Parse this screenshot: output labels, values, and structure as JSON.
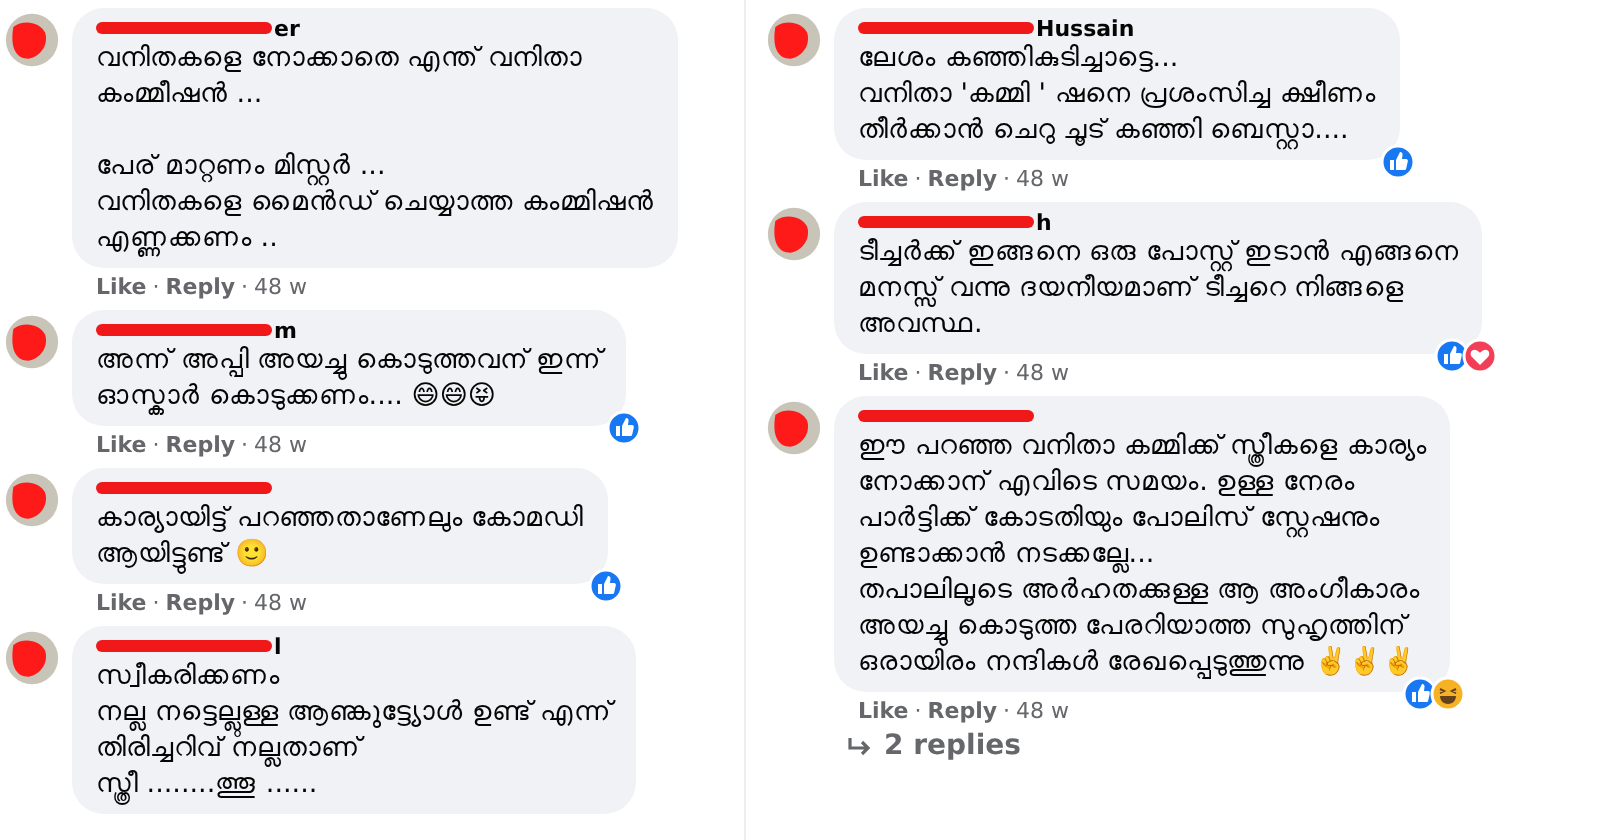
{
  "panels": [
    {
      "comments": [
        {
          "name": "er",
          "text": "വനിതകളെ നോക്കാതെ എന്ത് വനിതാ\nകംമ്മീഷൻ ...\n\nപേര് മാറ്റണം മിസ്റ്റർ ...\nവനിതകളെ മൈൻഡ് ചെയ്യാത്ത കംമ്മിഷൻ\nഎണ്ണക്കണം ..",
          "actions": [
            "Like",
            "Reply"
          ],
          "separator": "·",
          "time": "48 w"
        },
        {
          "name": "m",
          "text": "അന്ന് അപ്പി അയച്ചു കൊടുത്തവന് ഇന്ന്\nഓസ്കാർ കൊടുക്കണം.... 😄😄😝",
          "actions": [
            "Like",
            "Reply"
          ],
          "separator": "·",
          "time": "48 w",
          "reactions": [
            {
              "kind": "like"
            }
          ]
        },
        {
          "text": "കാര്യായിട്ട് പറഞ്ഞതാണേലും കോമഡി\nആയിട്ടുണ്ട് 🙂",
          "actions": [
            "Like",
            "Reply"
          ],
          "separator": "·",
          "time": "48 w",
          "reactions": [
            {
              "kind": "like"
            }
          ]
        },
        {
          "name": "l",
          "text": "സ്വീകരിക്കണം\nനല്ല നട്ടെല്ലുള്ള ആണ്കുട്ട്യോൾ ഉണ്ട് എന്ന്\nതിരിച്ചറിവ് നല്ലതാണ്\nസ്ത്രീ ........ത്തൂ ......"
        }
      ]
    },
    {
      "comments": [
        {
          "name": "Hussain",
          "text": "ലേശം കഞ്ഞികുടിച്ചാട്ടെ...\nവനിതാ 'കമ്മി ' ഷനെ പ്രശംസിച്ച ക്ഷീണം\nതീർക്കാൻ ചെറു ചൂട് കഞ്ഞി ബെസ്റ്റാ....",
          "actions": [
            "Like",
            "Reply"
          ],
          "separator": "·",
          "time": "48 w",
          "reactions": [
            {
              "kind": "like"
            }
          ]
        },
        {
          "name": "h",
          "text": "ടീച്ചർക്ക് ഇങ്ങനെ ഒരു പോസ്റ്റ് ഇടാൻ എങ്ങനെ\nമനസ്സ് വന്നു ദയനീയമാണ് ടീച്ചറെ നിങ്ങളെ\nഅവസ്ഥ.",
          "actions": [
            "Like",
            "Reply"
          ],
          "separator": "·",
          "time": "48 w",
          "reactions": [
            {
              "kind": "like"
            },
            {
              "kind": "love"
            }
          ]
        },
        {
          "text": "ഈ പറഞ്ഞ വനിതാ കമ്മിക്ക് സ്ത്രീകളെ കാര്യം\nനോക്കാന് എവിടെ സമയം. ഉള്ള നേരം\nപാർട്ടിക്ക് കോടതിയും പോലിസ് സ്റ്റേഷനും\nഉണ്ടാക്കാൻ നടക്കല്ലേ...\nതപാലിലൂടെ അർഹതക്കുള്ള ആ അംഗീകാരം\nഅയച്ചു കൊടുത്ത പേരറിയാത്ത സുഹൃത്തിന്\nഒരായിരം നന്ദികൾ രേഖപ്പെടുത്തുന്നു ✌️✌️✌️",
          "actions": [
            "Like",
            "Reply"
          ],
          "separator": "·",
          "time": "48 w",
          "reactions": [
            {
              "kind": "like"
            },
            {
              "kind": "haha"
            }
          ],
          "replies": "2 replies"
        }
      ]
    }
  ]
}
